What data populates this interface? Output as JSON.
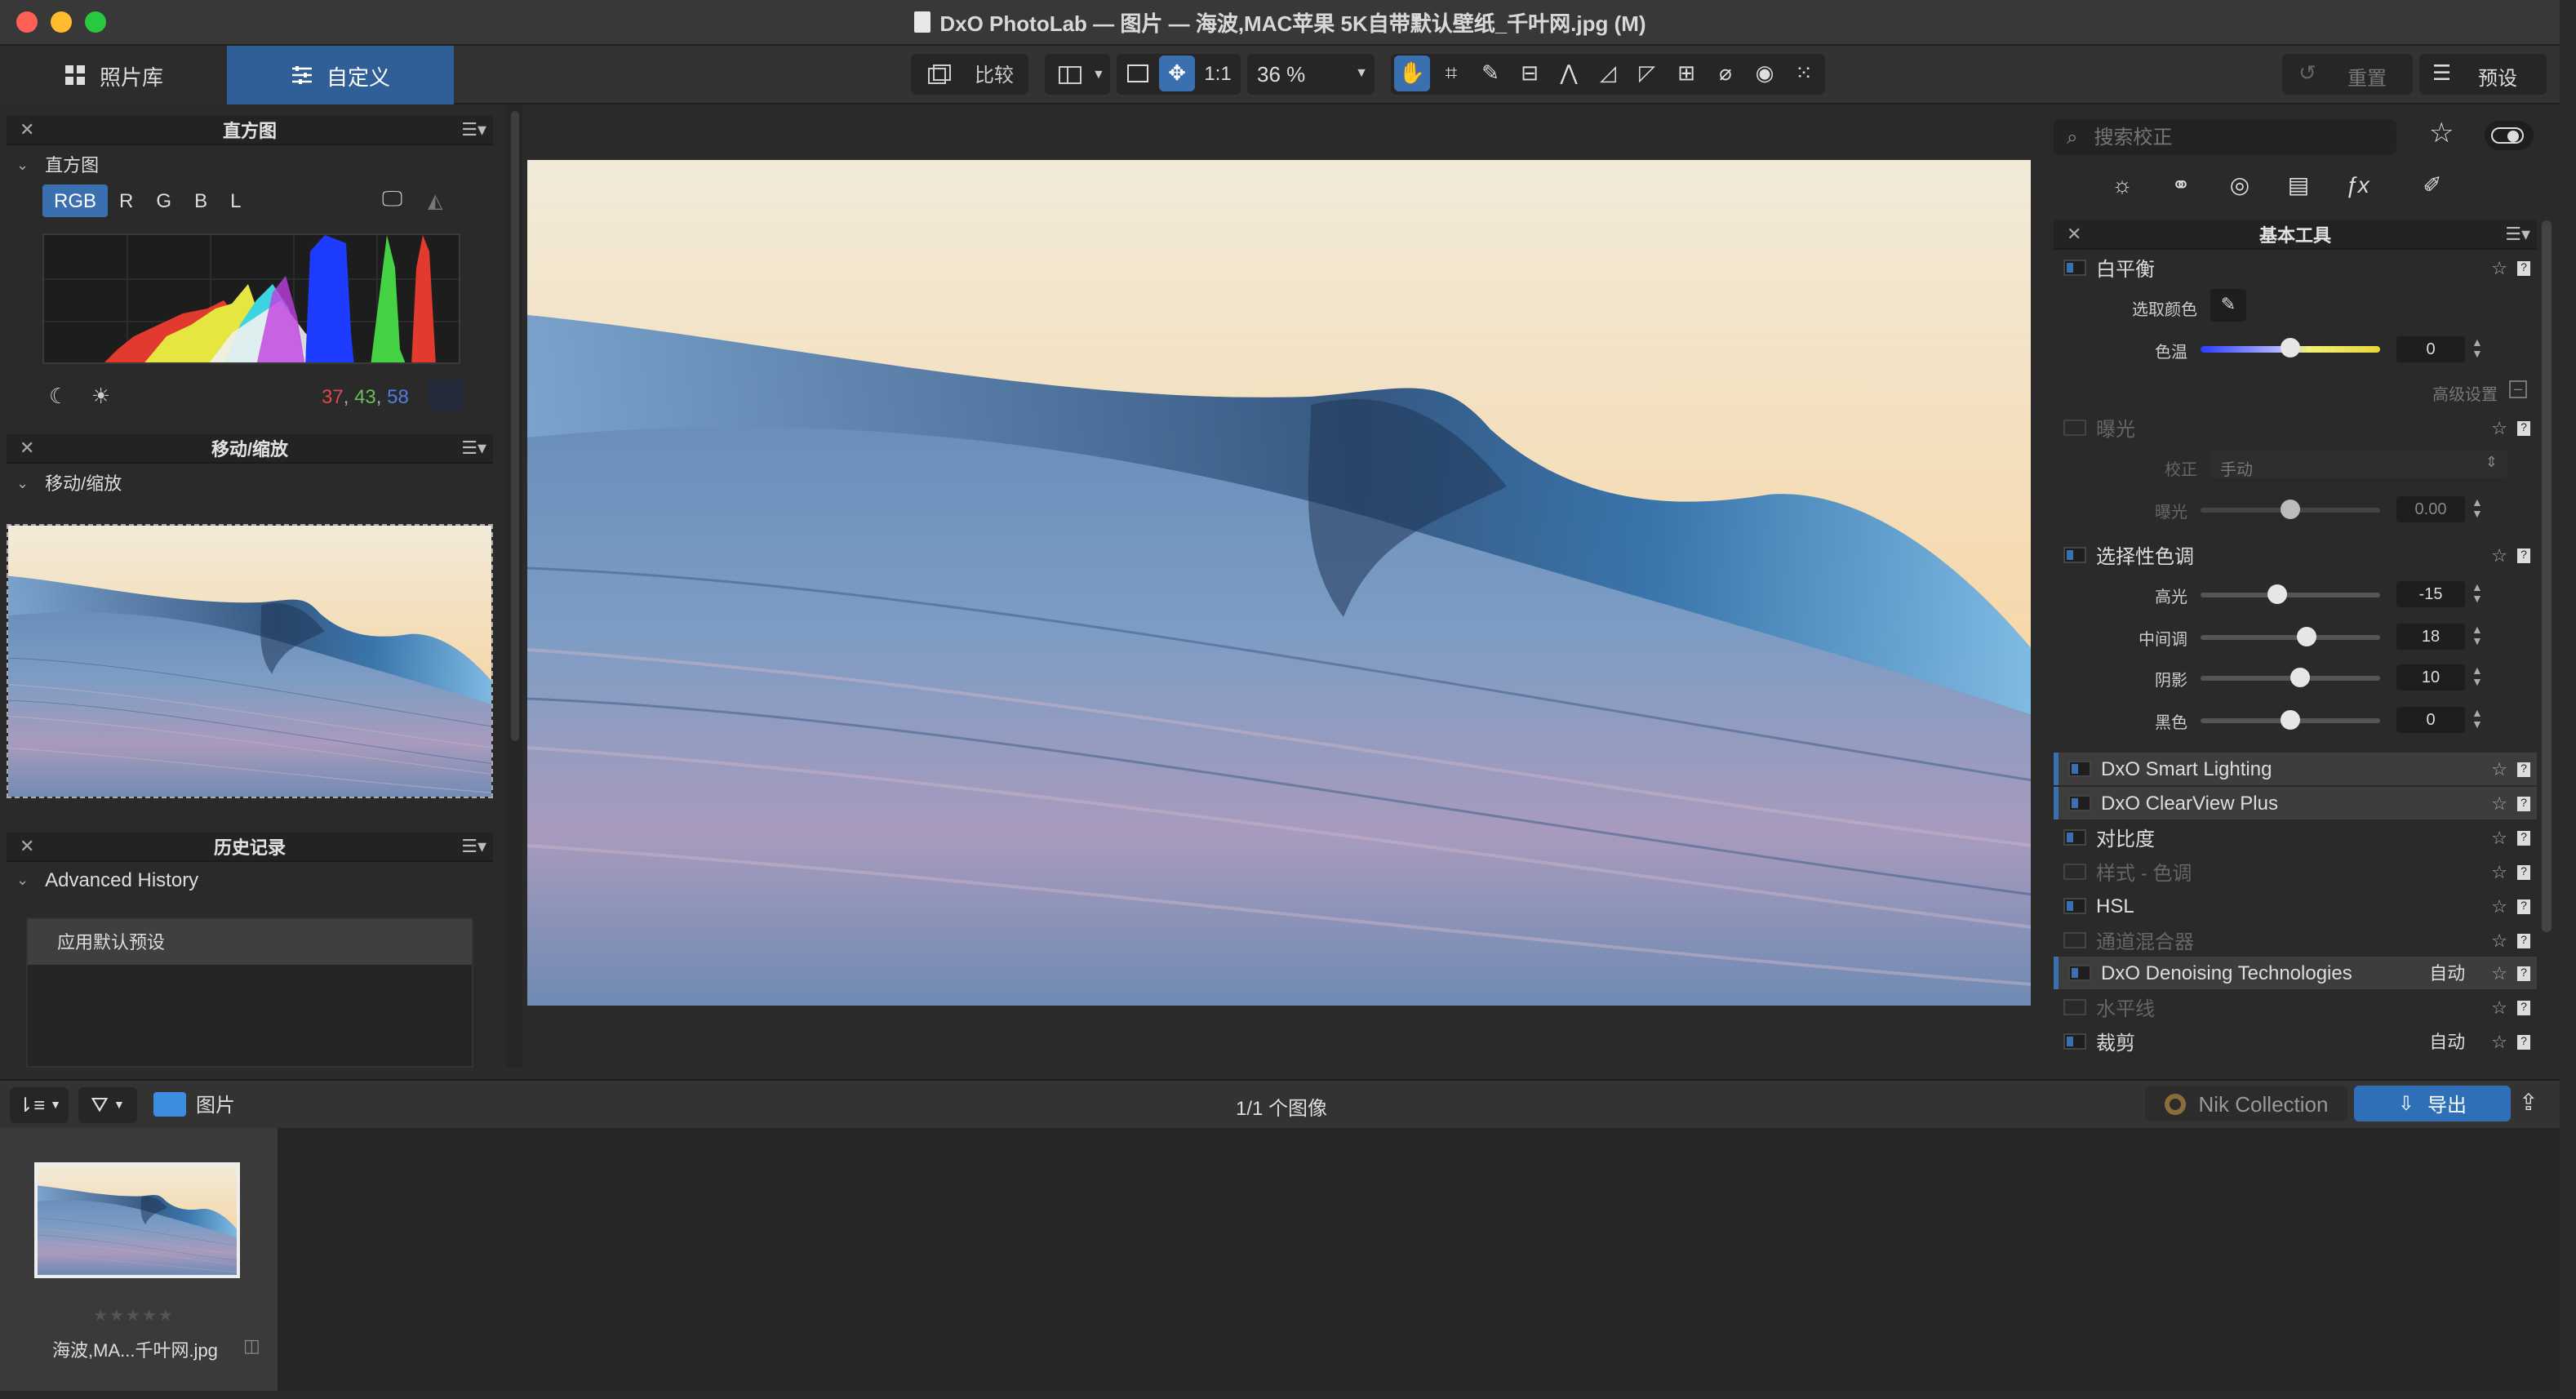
{
  "window": {
    "title": "DxO PhotoLab — 图片 — 海波,MAC苹果 5K自带默认壁纸_千叶网.jpg (M)"
  },
  "toolbar": {
    "tab_library": "照片库",
    "tab_custom": "自定义",
    "compare": "比较",
    "one_to_one": "1:1",
    "zoom": "36 %",
    "reset": "重置",
    "presets": "预设"
  },
  "histogram": {
    "panel_title": "直方图",
    "section": "直方图",
    "channels": [
      "RGB",
      "R",
      "G",
      "B",
      "L"
    ],
    "readout_r": "37",
    "readout_g": "43",
    "readout_b": "58"
  },
  "navigator": {
    "panel_title": "移动/缩放",
    "section": "移动/缩放"
  },
  "history": {
    "panel_title": "历史记录",
    "section": "Advanced History",
    "items": [
      "应用默认预设"
    ]
  },
  "corrections": {
    "search_placeholder": "搜索校正",
    "panel_title": "基本工具",
    "white_balance": "白平衡",
    "pick_color": "选取颜色",
    "temp_label": "色温",
    "temp_value": "0",
    "advanced": "高级设置",
    "exposure": "曝光",
    "correction_label": "校正",
    "correction_value": "手动",
    "exposure_label": "曝光",
    "exposure_value": "0.00",
    "selective_tone": "选择性色调",
    "highlights_label": "高光",
    "highlights_value": "-15",
    "midtones_label": "中间调",
    "midtones_value": "18",
    "shadows_label": "阴影",
    "shadows_value": "10",
    "blacks_label": "黑色",
    "blacks_value": "0",
    "tools": [
      {
        "name": "DxO Smart Lighting",
        "right": ""
      },
      {
        "name": "DxO ClearView Plus",
        "right": ""
      },
      {
        "name": "对比度",
        "right": ""
      },
      {
        "name": "样式 - 色调",
        "right": ""
      },
      {
        "name": "HSL",
        "right": ""
      },
      {
        "name": "通道混合器",
        "right": ""
      },
      {
        "name": "DxO Denoising Technologies",
        "right": "自动"
      },
      {
        "name": "水平线",
        "right": ""
      },
      {
        "name": "裁剪",
        "right": "自动"
      }
    ]
  },
  "bottom": {
    "folder": "图片",
    "count": "1/1 个图像",
    "nik": "Nik Collection",
    "export": "导出"
  },
  "filmstrip": {
    "filename": "海波,MA...千叶网.jpg",
    "stars": "★★★★★"
  },
  "colors": {
    "accent": "#3a6fb0",
    "export": "#2f6fb8",
    "readout_r": "#e0474c",
    "readout_g": "#6bbf59",
    "readout_b": "#4f7fdc"
  }
}
